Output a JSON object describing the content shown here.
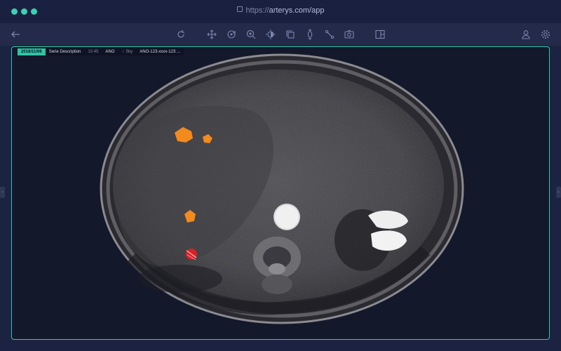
{
  "window": {
    "url_scheme": "https://",
    "url_host": "arterys.com/app",
    "dot_color": "#39d1b0"
  },
  "toolbar": {
    "icons": [
      "back-arrow-icon",
      "reset-icon",
      "pan-icon",
      "rotate-icon",
      "zoom-icon",
      "contrast-icon",
      "copy-icon",
      "slice-scroll-icon",
      "measure-icon",
      "screenshot-icon",
      "layout-icon",
      "user-icon",
      "settings-icon"
    ]
  },
  "viewer": {
    "info": {
      "date": "2018/11/06",
      "series": "Serie Description",
      "time": "10:45",
      "patient_id": "ANO",
      "patient_info": "♂ 5by",
      "accession": "ANO-123-xxxx-123 ..."
    },
    "accent_color": "#36c9a8",
    "lesion_color": "#f28a1e",
    "marker_color": "#e0262b"
  }
}
